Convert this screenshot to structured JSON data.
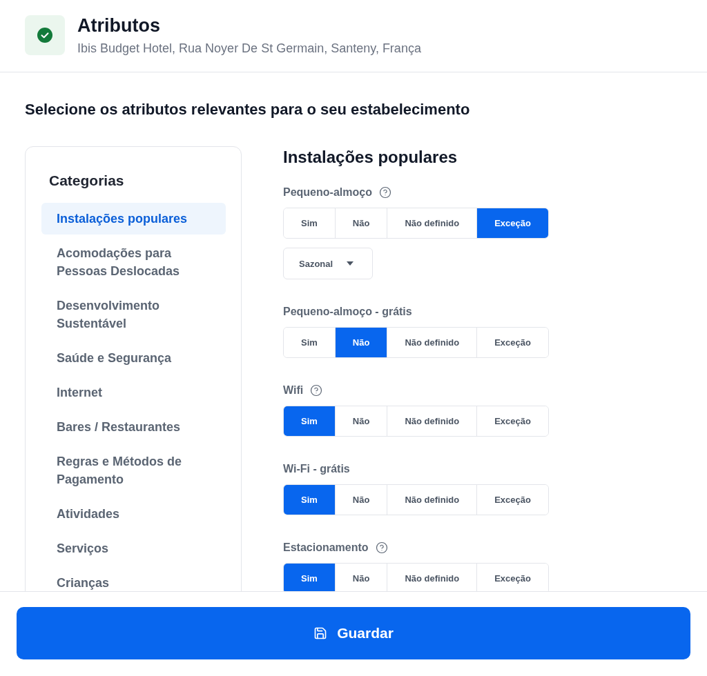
{
  "header": {
    "title": "Atributos",
    "subtitle": "Ibis Budget Hotel, Rua Noyer De St Germain, Santeny, França"
  },
  "prompt": "Selecione os atributos relevantes para o seu estabelecimento",
  "sidebar": {
    "title": "Categorias",
    "items": [
      {
        "label": "Instalações populares",
        "selected": true
      },
      {
        "label": "Acomodações para Pessoas Deslocadas",
        "selected": false
      },
      {
        "label": "Desenvolvimento Sustentável",
        "selected": false
      },
      {
        "label": "Saúde e Segurança",
        "selected": false
      },
      {
        "label": "Internet",
        "selected": false
      },
      {
        "label": "Bares / Restaurantes",
        "selected": false
      },
      {
        "label": "Regras e Métodos de Pagamento",
        "selected": false
      },
      {
        "label": "Atividades",
        "selected": false
      },
      {
        "label": "Serviços",
        "selected": false
      },
      {
        "label": "Crianças",
        "selected": false
      }
    ]
  },
  "section": {
    "title": "Instalações populares",
    "attributes": [
      {
        "label": "Pequeno-almoço",
        "help": true,
        "options": [
          {
            "label": "Sim",
            "selected": false
          },
          {
            "label": "Não",
            "selected": false
          },
          {
            "label": "Não definido",
            "selected": false
          },
          {
            "label": "Exceção",
            "selected": true
          }
        ],
        "dropdown": {
          "value": "Sazonal"
        }
      },
      {
        "label": "Pequeno-almoço - grátis",
        "help": false,
        "options": [
          {
            "label": "Sim",
            "selected": false
          },
          {
            "label": "Não",
            "selected": true
          },
          {
            "label": "Não definido",
            "selected": false
          },
          {
            "label": "Exceção",
            "selected": false
          }
        ]
      },
      {
        "label": "Wifi",
        "help": true,
        "options": [
          {
            "label": "Sim",
            "selected": true
          },
          {
            "label": "Não",
            "selected": false
          },
          {
            "label": "Não definido",
            "selected": false
          },
          {
            "label": "Exceção",
            "selected": false
          }
        ]
      },
      {
        "label": "Wi-Fi - grátis",
        "help": false,
        "options": [
          {
            "label": "Sim",
            "selected": true
          },
          {
            "label": "Não",
            "selected": false
          },
          {
            "label": "Não definido",
            "selected": false
          },
          {
            "label": "Exceção",
            "selected": false
          }
        ]
      },
      {
        "label": "Estacionamento",
        "help": true,
        "options": [
          {
            "label": "Sim",
            "selected": true
          },
          {
            "label": "Não",
            "selected": false
          },
          {
            "label": "Não definido",
            "selected": false
          },
          {
            "label": "Exceção",
            "selected": false
          }
        ]
      }
    ]
  },
  "save_button": {
    "label": "Guardar"
  }
}
